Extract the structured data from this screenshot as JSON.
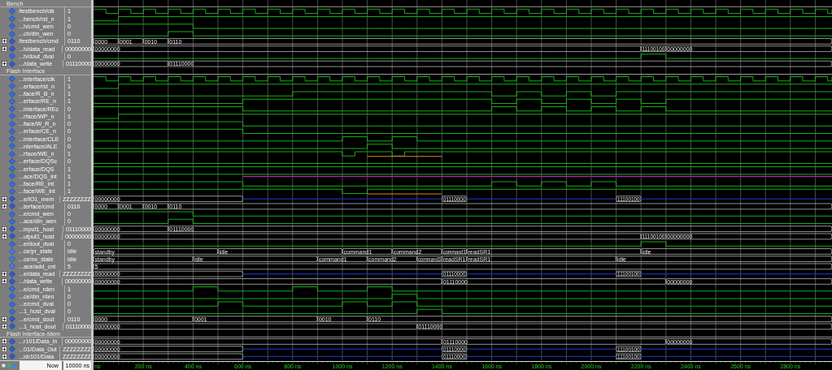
{
  "groups": [
    {
      "title": "Bench",
      "signals": [
        {
          "name": "/testbench/clk",
          "value": "1",
          "kind": "bit"
        },
        {
          "name": "...bench/rst_n",
          "value": "1",
          "kind": "bit"
        },
        {
          "name": "...h/cmd_wen",
          "value": "0",
          "kind": "bit"
        },
        {
          "name": "...ch/din_wen",
          "value": "0",
          "kind": "bit"
        },
        {
          "name": "/testbench/cmd",
          "value": "0110",
          "kind": "bus",
          "expanded": false,
          "segments": [
            "0000",
            "0001",
            "0010",
            "0110"
          ]
        },
        {
          "name": "...h/data_read",
          "value": "00000000",
          "kind": "bus",
          "expanded": false,
          "segments": [
            "00000000",
            "11100100",
            "00000000"
          ]
        },
        {
          "name": "...h/dout_dval",
          "value": "0",
          "kind": "bit"
        },
        {
          "name": ".../data_write",
          "value": "01110000",
          "kind": "bus",
          "expanded": false,
          "segments": [
            "00000000",
            "01110000"
          ]
        }
      ]
    },
    {
      "title": "Flash Interface",
      "signals": [
        {
          "name": "...interface/clk",
          "value": "1",
          "kind": "bit"
        },
        {
          "name": "...erface/rst_n",
          "value": "1",
          "kind": "bit"
        },
        {
          "name": "...face/R_B_n",
          "value": "1",
          "kind": "bit"
        },
        {
          "name": "...erface/RE_n",
          "value": "1",
          "kind": "bit"
        },
        {
          "name": "...interface/REc",
          "value": "0",
          "kind": "bit"
        },
        {
          "name": "...rface/WP_n",
          "value": "1",
          "kind": "bit"
        },
        {
          "name": "...face/W_R_n",
          "value": "0",
          "kind": "bit"
        },
        {
          "name": "...erface/CE_n",
          "value": "0",
          "kind": "bit"
        },
        {
          "name": "...interface/CLE",
          "value": "0",
          "kind": "bit"
        },
        {
          "name": "...nterface/ALE",
          "value": "0",
          "kind": "bit"
        },
        {
          "name": "...rface/WE_n",
          "value": "1",
          "kind": "bit"
        },
        {
          "name": "...erface/DQSc",
          "value": "0",
          "kind": "bit"
        },
        {
          "name": "...erface/DQS",
          "value": "1",
          "kind": "bit"
        },
        {
          "name": "...ace/DQS_int",
          "value": "1",
          "kind": "bit"
        },
        {
          "name": "...face/RE_int",
          "value": "1",
          "kind": "bit"
        },
        {
          "name": "...face/WE_int",
          "value": "1",
          "kind": "bit"
        },
        {
          "name": "...e/IO1_mem",
          "value": "ZZZZZZZZ",
          "kind": "bus",
          "expanded": false,
          "segments": [
            "00000000",
            "01110000",
            "11100100"
          ]
        },
        {
          "name": "...terface/cmd",
          "value": "0110",
          "kind": "bus",
          "expanded": false,
          "segments": [
            "0000",
            "0001",
            "0010",
            "0110"
          ]
        },
        {
          "name": "...e/cmd_wen",
          "value": "0",
          "kind": "bit"
        },
        {
          "name": "...ace/din_wen",
          "value": "0",
          "kind": "bit"
        },
        {
          "name": "...input1_host",
          "value": "01110000",
          "kind": "bus",
          "expanded": false,
          "segments": [
            "00000000",
            "01110000"
          ]
        },
        {
          "name": "...utput1_host",
          "value": "00000000",
          "kind": "bus",
          "expanded": false,
          "segments": [
            "00000000",
            "11100100",
            "00000000"
          ]
        },
        {
          "name": "...e/dout_dval",
          "value": "0",
          "kind": "bit"
        },
        {
          "name": "...ce/pr_state",
          "value": "idle",
          "kind": "enum",
          "segments": [
            "standby",
            "idle",
            "command1",
            "command2",
            "command3",
            "readSR1",
            "idle"
          ]
        },
        {
          "name": "...ce/nx_state",
          "value": "idle",
          "kind": "enum",
          "segments": [
            "standby",
            "idle",
            "command1",
            "command2",
            "command3",
            "readSR1",
            "readSR1",
            "idle"
          ]
        },
        {
          "name": "...ace/add_cnt",
          "value": "5",
          "kind": "enum",
          "segments": [
            "5"
          ]
        },
        {
          "name": "...e/data_read",
          "value": "ZZZZZZZZ",
          "kind": "bus",
          "expanded": false,
          "segments": [
            "00000000",
            "01110000",
            "11100100"
          ]
        },
        {
          "name": ".../data_write",
          "value": "00000000",
          "kind": "bus",
          "expanded": false,
          "segments": [
            "00000000",
            "01110000",
            "00000000"
          ]
        },
        {
          "name": "...e/cmd_rden",
          "value": "1",
          "kind": "bit"
        },
        {
          "name": "...ce/din_rden",
          "value": "0",
          "kind": "bit"
        },
        {
          "name": "...e/cmd_dval",
          "value": "0",
          "kind": "bit"
        },
        {
          "name": "...1_host_dval",
          "value": "0",
          "kind": "bit"
        },
        {
          "name": "...e/cmd_dout",
          "value": "0110",
          "kind": "bus",
          "expanded": false,
          "segments": [
            "0000",
            "0001",
            "0010",
            "0110"
          ]
        },
        {
          "name": "...1_host_dout",
          "value": "01110000",
          "kind": "bus",
          "expanded": false,
          "segments": [
            "00000000",
            "01110000"
          ]
        }
      ]
    },
    {
      "title": "Flash Interface-Mem",
      "signals": [
        {
          "name": "...r101/Data_In",
          "value": "00000000",
          "kind": "bus",
          "expanded": false,
          "segments": [
            "00000000",
            "01110000",
            "00000000"
          ]
        },
        {
          "name": "...01/Data_Out",
          "value": "ZZZZZZZZ",
          "kind": "bus",
          "expanded": false,
          "segments": [
            "00000000",
            "01110000",
            "11100100"
          ]
        },
        {
          "name": "...idr101/Data",
          "value": "ZZZZZZZZ",
          "kind": "bus",
          "expanded": false,
          "segments": [
            "00000000",
            "01110000",
            "11100100"
          ]
        }
      ]
    }
  ],
  "now": {
    "label": "Now",
    "time": "10000 ns"
  },
  "timeline": [
    "ns",
    "200 ns",
    "400 ns",
    "600 ns",
    "800 ns",
    "1000 ns",
    "1200 ns",
    "1400 ns",
    "1600 ns",
    "1800 ns",
    "2000 ns",
    "2200 ns",
    "2400 ns",
    "2600 ns",
    "2800 ns"
  ]
}
